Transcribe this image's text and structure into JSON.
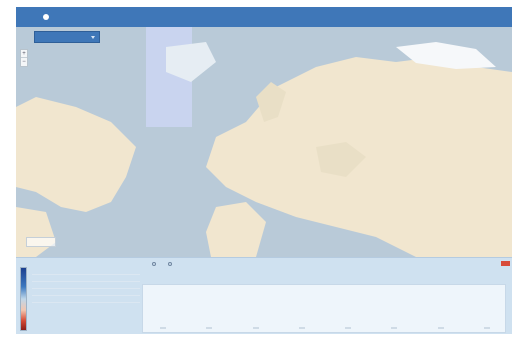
{
  "window": {
    "title": "",
    "subtitle": ""
  },
  "map": {
    "layer_select": "",
    "zoom_in": "+",
    "zoom_out": "−",
    "badge": ""
  },
  "panel": {
    "stats_title": "",
    "stats": [
      {
        "label": "",
        "value": ""
      },
      {
        "label": "",
        "value": ""
      },
      {
        "label": "",
        "value": ""
      },
      {
        "label": "",
        "value": ""
      },
      {
        "label": "",
        "value": ""
      }
    ],
    "notes": [
      "",
      "",
      "",
      "",
      ""
    ],
    "toolbar": {
      "chart_label": "",
      "option_a": "",
      "option_b": "",
      "right_text": ""
    },
    "yticks": [
      "",
      "",
      "",
      "",
      ""
    ]
  },
  "colors": {
    "accent": "#3f77b8",
    "close": "#d84b3a",
    "panel": "#cfe1f0",
    "land": "#f1e6cf",
    "ocean": "#b9cad8"
  }
}
